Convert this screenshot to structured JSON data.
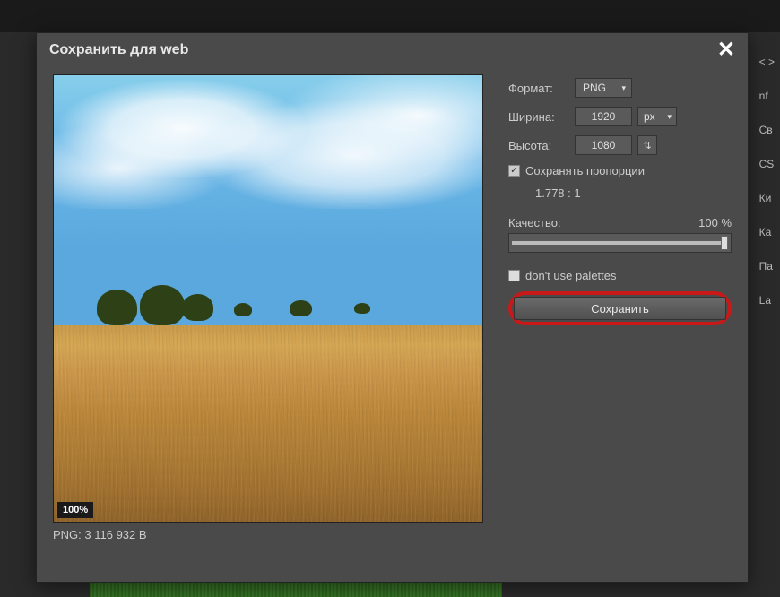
{
  "dialog": {
    "title": "Сохранить для web"
  },
  "preview": {
    "zoom": "100%",
    "filesize": "PNG: 3 116 932 B"
  },
  "controls": {
    "format": {
      "label": "Формат:",
      "value": "PNG"
    },
    "width": {
      "label": "Ширина:",
      "value": "1920",
      "unit": "px"
    },
    "height": {
      "label": "Высота:",
      "value": "1080"
    },
    "keepRatio": {
      "checked": true,
      "label": "Сохранять пропорции"
    },
    "ratio": "1.778 : 1",
    "quality": {
      "label": "Качество:",
      "value": "100",
      "unit": "%"
    },
    "palettes": {
      "checked": false,
      "label": "don't use palettes"
    },
    "saveLabel": "Сохранить"
  },
  "bg": {
    "items": [
      "< >",
      "nf",
      "Св",
      "CS",
      "Ки",
      "Ка",
      "Па",
      "La"
    ]
  }
}
